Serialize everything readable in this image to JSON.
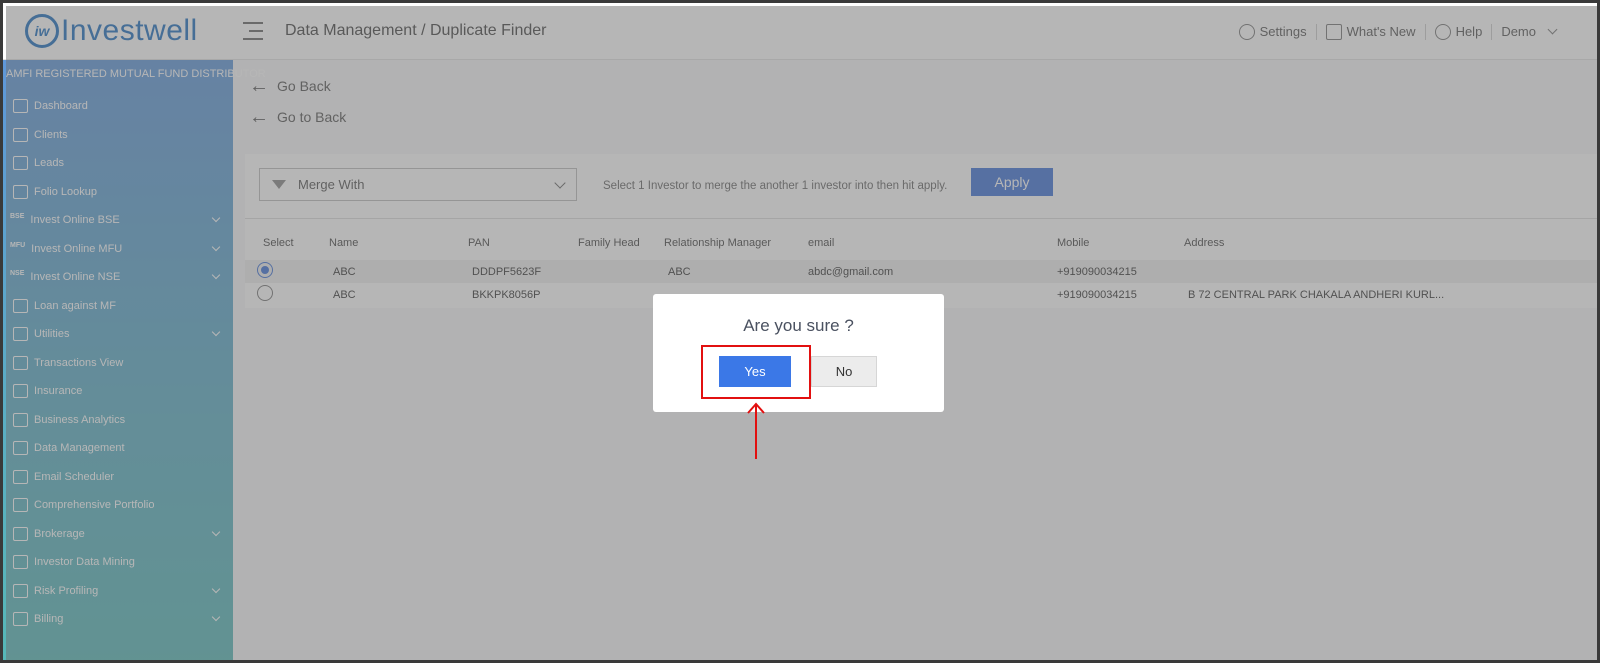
{
  "header": {
    "logo_mark": "iw",
    "logo_text": "Investwell",
    "breadcrumb": "Data Management / Duplicate Finder",
    "settings": "Settings",
    "whats_new": "What's New",
    "help": "Help",
    "user": "Demo"
  },
  "sidebar": {
    "banner": "AMFI REGISTERED MUTUAL FUND DISTRIBUTOR",
    "items": [
      {
        "label": "Dashboard",
        "icon": "home-icon",
        "chevron": false
      },
      {
        "label": "Clients",
        "icon": "users-icon",
        "chevron": false
      },
      {
        "label": "Leads",
        "icon": "leads-icon",
        "chevron": false
      },
      {
        "label": "Folio Lookup",
        "icon": "folio-icon",
        "chevron": false
      },
      {
        "label": "Invest Online BSE",
        "icon": "BSE",
        "chevron": true
      },
      {
        "label": "Invest Online MFU",
        "icon": "MFU",
        "chevron": true
      },
      {
        "label": "Invest Online NSE",
        "icon": "NSE",
        "chevron": true
      },
      {
        "label": "Loan against MF",
        "icon": "loan-icon",
        "chevron": false
      },
      {
        "label": "Utilities",
        "icon": "utilities-icon",
        "chevron": true
      },
      {
        "label": "Transactions View",
        "icon": "transactions-icon",
        "chevron": false
      },
      {
        "label": "Insurance",
        "icon": "insurance-icon",
        "chevron": false
      },
      {
        "label": "Business Analytics",
        "icon": "analytics-icon",
        "chevron": false
      },
      {
        "label": "Data Management",
        "icon": "data-icon",
        "chevron": false
      },
      {
        "label": "Email Scheduler",
        "icon": "email-icon",
        "chevron": false
      },
      {
        "label": "Comprehensive Portfolio",
        "icon": "portfolio-icon",
        "chevron": false
      },
      {
        "label": "Brokerage",
        "icon": "brokerage-icon",
        "chevron": true
      },
      {
        "label": "Investor Data Mining",
        "icon": "rupee-icon",
        "chevron": false
      },
      {
        "label": "Risk Profiling",
        "icon": "risk-icon",
        "chevron": true
      },
      {
        "label": "Billing",
        "icon": "billing-icon",
        "chevron": true
      }
    ]
  },
  "main": {
    "go_back": "Go Back",
    "go_to_back": "Go to Back",
    "merge_select": "Merge With",
    "hint": "Select 1 Investor to merge the another 1 investor into then hit apply.",
    "apply": "Apply",
    "columns": [
      "Select",
      "Name",
      "PAN",
      "Family Head",
      "Relationship Manager",
      "email",
      "Mobile",
      "Address"
    ],
    "rows": [
      {
        "selected": true,
        "name": "ABC",
        "pan": "DDDPF5623F",
        "family_head": "",
        "rm": "ABC",
        "email": "abdc@gmail.com",
        "mobile": "+919090034215",
        "address": ""
      },
      {
        "selected": false,
        "name": "ABC",
        "pan": "BKKPK8056P",
        "family_head": "",
        "rm": "",
        "email": "",
        "mobile": "+919090034215",
        "address": "B 72 CENTRAL PARK CHAKALA ANDHERI KURL..."
      }
    ]
  },
  "dialog": {
    "title": "Are you sure ?",
    "yes": "Yes",
    "no": "No"
  },
  "colors": {
    "brand": "#1e6fbe",
    "primary_button": "#3b78e7",
    "annotation": "#e21010"
  }
}
